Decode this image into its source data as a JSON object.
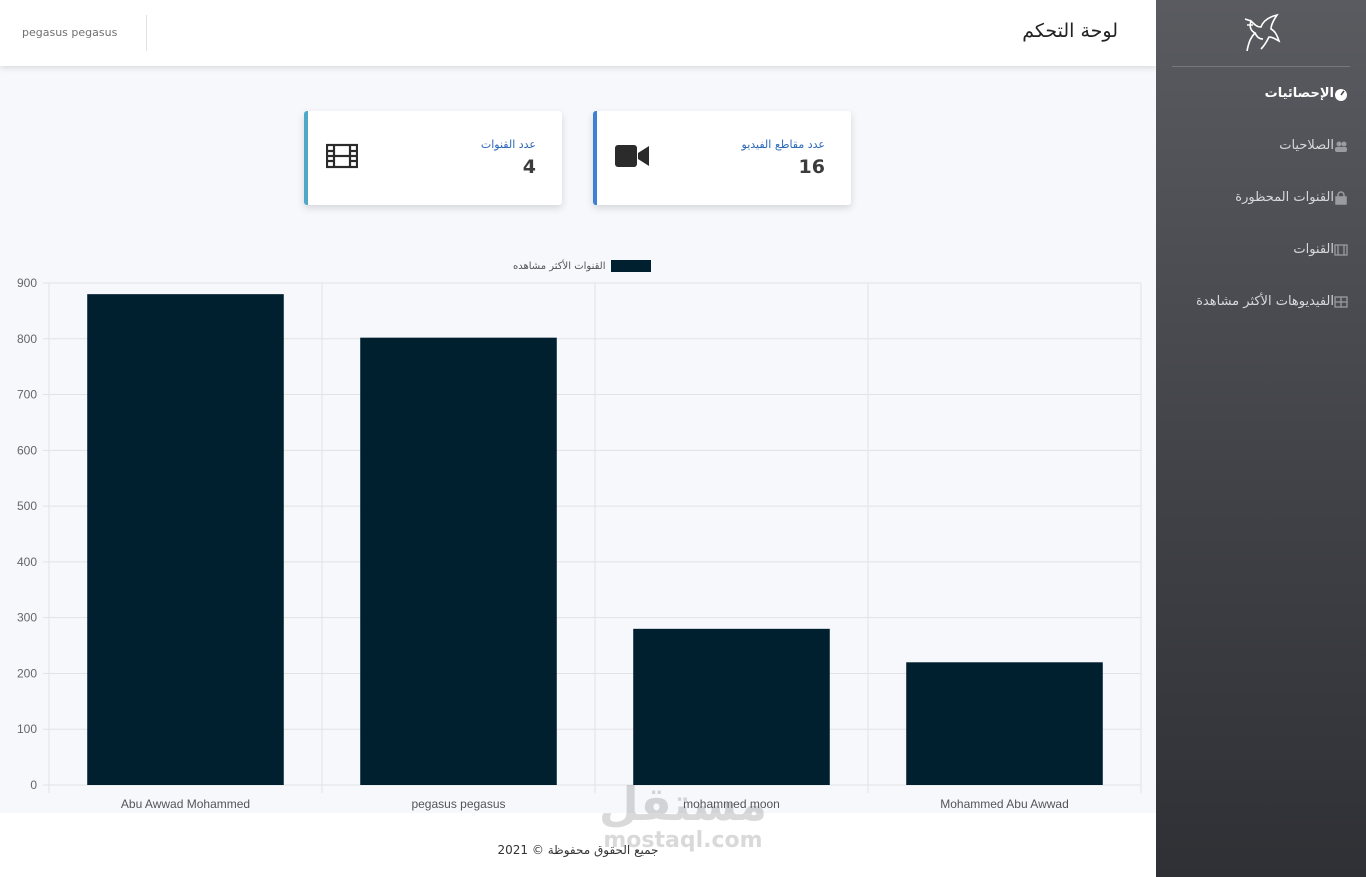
{
  "header": {
    "title": "لوحة التحكم",
    "user": "pegasus pegasus"
  },
  "sidebar": {
    "logo_icon": "pegasus-logo-icon",
    "items": [
      {
        "label": "الإحصائيات",
        "icon": "dashboard-icon",
        "active": true
      },
      {
        "label": "الصلاحيات",
        "icon": "users-icon",
        "active": false
      },
      {
        "label": "القنوات المحظورة",
        "icon": "lock-icon",
        "active": false
      },
      {
        "label": "القنوات",
        "icon": "film-icon",
        "active": false
      },
      {
        "label": "الفيديوهات الأكثر مشاهدة",
        "icon": "table-icon",
        "active": false
      }
    ]
  },
  "cards": [
    {
      "label": "عدد مقاطع الفيديو",
      "value": "16",
      "icon": "video-camera-icon",
      "accent": "#3f7fd4"
    },
    {
      "label": "عدد القنوات",
      "value": "4",
      "icon": "film-icon",
      "accent": "#4fa8c8"
    }
  ],
  "chart_data": {
    "type": "bar",
    "legend": "القنوات الأكثر مشاهده",
    "legend_position": "top",
    "categories": [
      "Abu Awwad Mohammed",
      "pegasus pegasus",
      "mohammed moon",
      "Mohammed Abu Awwad"
    ],
    "values": [
      880,
      802,
      280,
      220
    ],
    "ylim": [
      0,
      900
    ],
    "yticks": [
      "0",
      "100",
      "200",
      "300",
      "400",
      "500",
      "600",
      "700",
      "800",
      "900"
    ],
    "bar_color": "#002030",
    "grid": true
  },
  "footer": {
    "text": "جميع الحقوق محفوظة © 2021"
  },
  "watermark": {
    "line1": "مستقل",
    "line2": "mostaql.com"
  }
}
